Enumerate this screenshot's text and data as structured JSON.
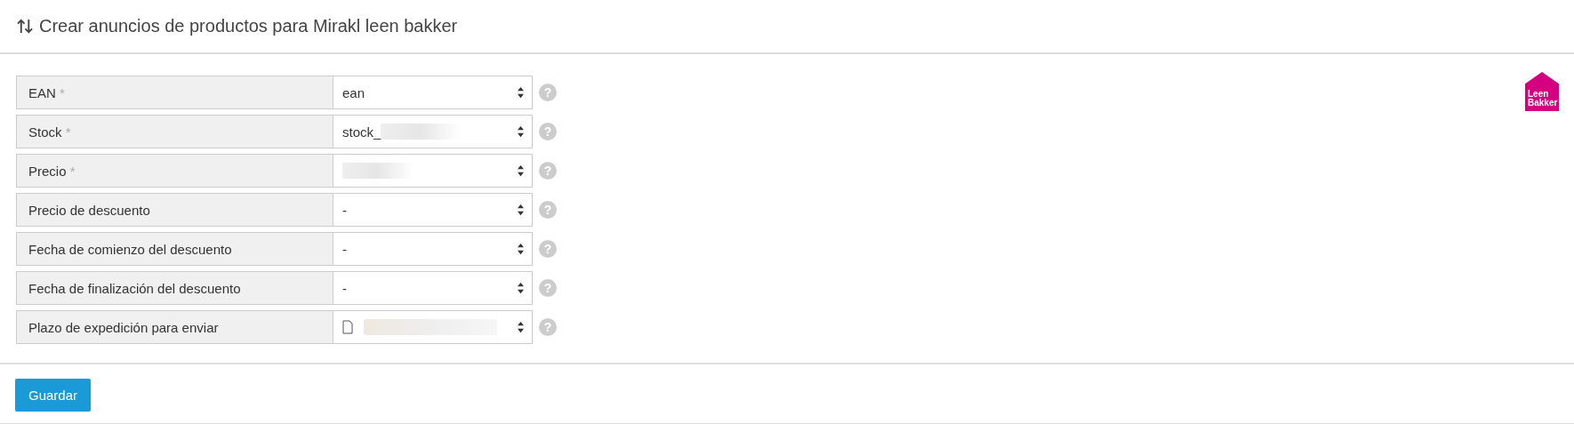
{
  "header": {
    "title": "Crear anuncios de productos para Mirakl leen bakker"
  },
  "logo": {
    "lines": [
      "Leen",
      "Bakker"
    ]
  },
  "rows": [
    {
      "label": "EAN",
      "required": true,
      "value": "ean",
      "redacted": false,
      "file_icon": false
    },
    {
      "label": "Stock",
      "required": true,
      "value": "stock_",
      "redacted": true,
      "file_icon": false
    },
    {
      "label": "Precio",
      "required": true,
      "redacted": true,
      "file_icon": false
    },
    {
      "label": "Precio de descuento",
      "required": false,
      "value": "-",
      "redacted": false,
      "file_icon": false
    },
    {
      "label": "Fecha de comienzo del descuento",
      "required": false,
      "value": "-",
      "redacted": false,
      "file_icon": false
    },
    {
      "label": "Fecha de finalización del descuento",
      "required": false,
      "value": "-",
      "redacted": false,
      "file_icon": false
    },
    {
      "label": "Plazo de expedición para enviar",
      "required": false,
      "redacted": true,
      "file_icon": true
    }
  ],
  "required_mark": "*",
  "help_mark": "?",
  "save_button": "Guardar"
}
